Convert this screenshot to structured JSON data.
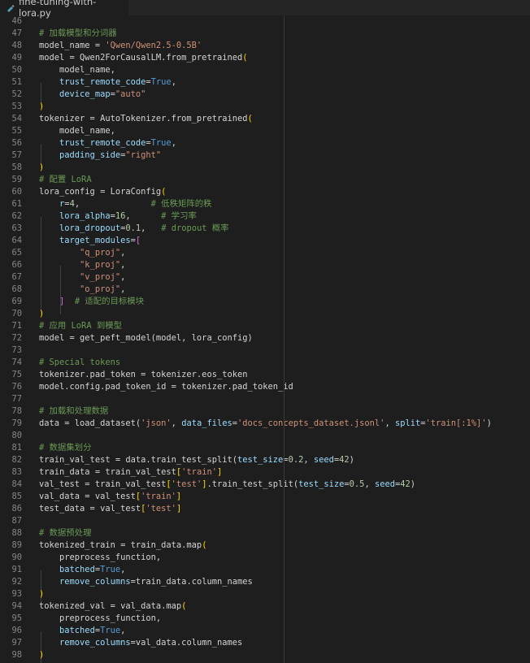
{
  "tab": {
    "filename": "fine-tuning-with-lora.py",
    "icon": "python-file-icon"
  },
  "colors": {
    "background": "#1e1e1e",
    "comment": "#6a9955",
    "string": "#ce9178",
    "number": "#b5cea8",
    "keyword": "#569cd6",
    "parameter": "#9cdcfe",
    "bracket_gold": "#ffd700",
    "bracket_purple": "#da70d6"
  },
  "lines": [
    {
      "n": "46",
      "t": []
    },
    {
      "n": "47",
      "t": [
        [
          "c",
          "# 加载模型和分词器"
        ]
      ]
    },
    {
      "n": "48",
      "t": [
        [
          "d",
          "model_name = "
        ],
        [
          "s",
          "'Qwen/Qwen2.5-0.5B'"
        ]
      ]
    },
    {
      "n": "49",
      "t": [
        [
          "d",
          "model = Qwen2ForCausalLM.from_pretrained"
        ],
        [
          "b1",
          "("
        ]
      ]
    },
    {
      "n": "50",
      "t": [
        [
          "d",
          "    model_name,"
        ]
      ]
    },
    {
      "n": "51",
      "t": [
        [
          "d",
          "    "
        ],
        [
          "p",
          "trust_remote_code"
        ],
        [
          "d",
          "="
        ],
        [
          "k",
          "True"
        ],
        [
          "d",
          ","
        ]
      ]
    },
    {
      "n": "52",
      "t": [
        [
          "d",
          "    "
        ],
        [
          "p",
          "device_map"
        ],
        [
          "d",
          "="
        ],
        [
          "s",
          "\"auto\""
        ]
      ]
    },
    {
      "n": "53",
      "t": [
        [
          "b1",
          ")"
        ]
      ]
    },
    {
      "n": "54",
      "t": [
        [
          "d",
          "tokenizer = AutoTokenizer.from_pretrained"
        ],
        [
          "b1",
          "("
        ]
      ]
    },
    {
      "n": "55",
      "t": [
        [
          "d",
          "    model_name,"
        ]
      ]
    },
    {
      "n": "56",
      "t": [
        [
          "d",
          "    "
        ],
        [
          "p",
          "trust_remote_code"
        ],
        [
          "d",
          "="
        ],
        [
          "k",
          "True"
        ],
        [
          "d",
          ","
        ]
      ]
    },
    {
      "n": "57",
      "t": [
        [
          "d",
          "    "
        ],
        [
          "p",
          "padding_side"
        ],
        [
          "d",
          "="
        ],
        [
          "s",
          "\"right\""
        ]
      ]
    },
    {
      "n": "58",
      "t": [
        [
          "b1",
          ")"
        ]
      ]
    },
    {
      "n": "59",
      "t": [
        [
          "c",
          "# 配置 LoRA"
        ]
      ]
    },
    {
      "n": "60",
      "t": [
        [
          "d",
          "lora_config = LoraConfig"
        ],
        [
          "b1",
          "("
        ]
      ]
    },
    {
      "n": "61",
      "t": [
        [
          "d",
          "    "
        ],
        [
          "p",
          "r"
        ],
        [
          "d",
          "="
        ],
        [
          "n",
          "4"
        ],
        [
          "d",
          ",              "
        ],
        [
          "c",
          "# 低秩矩阵的秩"
        ]
      ]
    },
    {
      "n": "62",
      "t": [
        [
          "d",
          "    "
        ],
        [
          "p",
          "lora_alpha"
        ],
        [
          "d",
          "="
        ],
        [
          "n",
          "16"
        ],
        [
          "d",
          ",      "
        ],
        [
          "c",
          "# 学习率"
        ]
      ]
    },
    {
      "n": "63",
      "t": [
        [
          "d",
          "    "
        ],
        [
          "p",
          "lora_dropout"
        ],
        [
          "d",
          "="
        ],
        [
          "n",
          "0.1"
        ],
        [
          "d",
          ",   "
        ],
        [
          "c",
          "# dropout 概率"
        ]
      ]
    },
    {
      "n": "64",
      "t": [
        [
          "d",
          "    "
        ],
        [
          "p",
          "target_modules"
        ],
        [
          "d",
          "="
        ],
        [
          "b2",
          "["
        ]
      ]
    },
    {
      "n": "65",
      "t": [
        [
          "d",
          "        "
        ],
        [
          "s",
          "\"q_proj\""
        ],
        [
          "d",
          ","
        ]
      ]
    },
    {
      "n": "66",
      "t": [
        [
          "d",
          "        "
        ],
        [
          "s",
          "\"k_proj\""
        ],
        [
          "d",
          ","
        ]
      ]
    },
    {
      "n": "67",
      "t": [
        [
          "d",
          "        "
        ],
        [
          "s",
          "\"v_proj\""
        ],
        [
          "d",
          ","
        ]
      ]
    },
    {
      "n": "68",
      "t": [
        [
          "d",
          "        "
        ],
        [
          "s",
          "\"o_proj\""
        ],
        [
          "d",
          ","
        ]
      ]
    },
    {
      "n": "69",
      "t": [
        [
          "d",
          "    "
        ],
        [
          "b2",
          "]"
        ],
        [
          "d",
          "  "
        ],
        [
          "c",
          "# 适配的目标模块"
        ]
      ]
    },
    {
      "n": "70",
      "t": [
        [
          "b1",
          ")"
        ]
      ]
    },
    {
      "n": "71",
      "t": [
        [
          "c",
          "# 应用 LoRA 到模型"
        ]
      ]
    },
    {
      "n": "72",
      "t": [
        [
          "d",
          "model = get_peft_model(model, lora_config)"
        ]
      ]
    },
    {
      "n": "73",
      "t": []
    },
    {
      "n": "74",
      "t": [
        [
          "c",
          "# Special tokens"
        ]
      ]
    },
    {
      "n": "75",
      "t": [
        [
          "d",
          "tokenizer.pad_token = tokenizer.eos_token"
        ]
      ]
    },
    {
      "n": "76",
      "t": [
        [
          "d",
          "model.config.pad_token_id = tokenizer.pad_token_id"
        ]
      ]
    },
    {
      "n": "77",
      "t": []
    },
    {
      "n": "78",
      "t": [
        [
          "c",
          "# 加载和处理数据"
        ]
      ]
    },
    {
      "n": "79",
      "t": [
        [
          "d",
          "data = load_dataset("
        ],
        [
          "s",
          "'json'"
        ],
        [
          "d",
          ", "
        ],
        [
          "p",
          "data_files"
        ],
        [
          "d",
          "="
        ],
        [
          "s",
          "'docs_concepts_dataset.jsonl'"
        ],
        [
          "d",
          ", "
        ],
        [
          "p",
          "split"
        ],
        [
          "d",
          "="
        ],
        [
          "s",
          "'train[:1%]'"
        ],
        [
          "d",
          ")"
        ]
      ]
    },
    {
      "n": "80",
      "t": []
    },
    {
      "n": "81",
      "t": [
        [
          "c",
          "# 数据集划分"
        ]
      ]
    },
    {
      "n": "82",
      "t": [
        [
          "d",
          "train_val_test = data.train_test_split("
        ],
        [
          "p",
          "test_size"
        ],
        [
          "d",
          "="
        ],
        [
          "n",
          "0.2"
        ],
        [
          "d",
          ", "
        ],
        [
          "p",
          "seed"
        ],
        [
          "d",
          "="
        ],
        [
          "n",
          "42"
        ],
        [
          "d",
          ")"
        ]
      ]
    },
    {
      "n": "83",
      "t": [
        [
          "d",
          "train_data = train_val_test"
        ],
        [
          "b1",
          "["
        ],
        [
          "s",
          "'train'"
        ],
        [
          "b1",
          "]"
        ]
      ]
    },
    {
      "n": "84",
      "t": [
        [
          "d",
          "val_test = train_val_test"
        ],
        [
          "b1",
          "["
        ],
        [
          "s",
          "'test'"
        ],
        [
          "b1",
          "]"
        ],
        [
          "d",
          ".train_test_split("
        ],
        [
          "p",
          "test_size"
        ],
        [
          "d",
          "="
        ],
        [
          "n",
          "0.5"
        ],
        [
          "d",
          ", "
        ],
        [
          "p",
          "seed"
        ],
        [
          "d",
          "="
        ],
        [
          "n",
          "42"
        ],
        [
          "d",
          ")"
        ]
      ]
    },
    {
      "n": "85",
      "t": [
        [
          "d",
          "val_data = val_test"
        ],
        [
          "b1",
          "["
        ],
        [
          "s",
          "'train'"
        ],
        [
          "b1",
          "]"
        ]
      ]
    },
    {
      "n": "86",
      "t": [
        [
          "d",
          "test_data = val_test"
        ],
        [
          "b1",
          "["
        ],
        [
          "s",
          "'test'"
        ],
        [
          "b1",
          "]"
        ]
      ]
    },
    {
      "n": "87",
      "t": []
    },
    {
      "n": "88",
      "t": [
        [
          "c",
          "# 数据预处理"
        ]
      ]
    },
    {
      "n": "89",
      "t": [
        [
          "d",
          "tokenized_train = train_data.map"
        ],
        [
          "b1",
          "("
        ]
      ]
    },
    {
      "n": "90",
      "t": [
        [
          "d",
          "    preprocess_function,"
        ]
      ]
    },
    {
      "n": "91",
      "t": [
        [
          "d",
          "    "
        ],
        [
          "p",
          "batched"
        ],
        [
          "d",
          "="
        ],
        [
          "k",
          "True"
        ],
        [
          "d",
          ","
        ]
      ]
    },
    {
      "n": "92",
      "t": [
        [
          "d",
          "    "
        ],
        [
          "p",
          "remove_columns"
        ],
        [
          "d",
          "=train_data.column_names"
        ]
      ]
    },
    {
      "n": "93",
      "t": [
        [
          "b1",
          ")"
        ]
      ]
    },
    {
      "n": "94",
      "t": [
        [
          "d",
          "tokenized_val = val_data.map"
        ],
        [
          "b1",
          "("
        ]
      ]
    },
    {
      "n": "95",
      "t": [
        [
          "d",
          "    preprocess_function,"
        ]
      ]
    },
    {
      "n": "96",
      "t": [
        [
          "d",
          "    "
        ],
        [
          "p",
          "batched"
        ],
        [
          "d",
          "="
        ],
        [
          "k",
          "True"
        ],
        [
          "d",
          ","
        ]
      ]
    },
    {
      "n": "97",
      "t": [
        [
          "d",
          "    "
        ],
        [
          "p",
          "remove_columns"
        ],
        [
          "d",
          "=val_data.column_names"
        ]
      ]
    },
    {
      "n": "98",
      "t": [
        [
          "b1",
          ")"
        ]
      ]
    }
  ]
}
